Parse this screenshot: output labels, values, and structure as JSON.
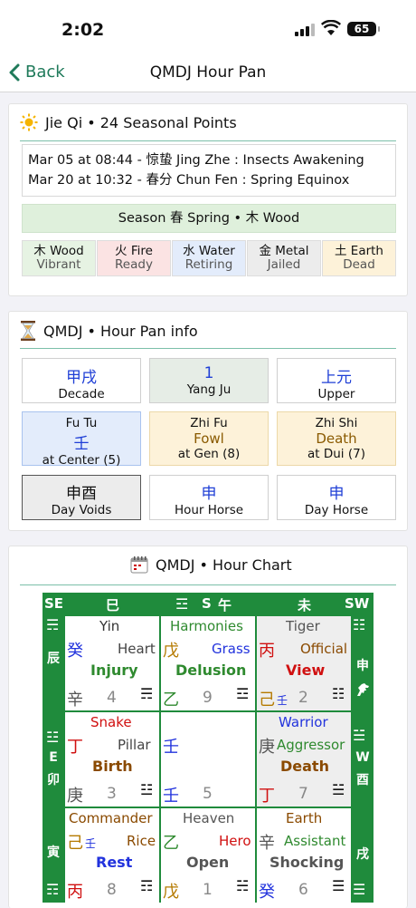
{
  "status": {
    "time": "2:02",
    "battery": "65"
  },
  "nav": {
    "back": "Back",
    "title": "QMDJ Hour Pan"
  },
  "jieqi": {
    "icon": "sun-icon",
    "title": "Jie Qi • 24 Seasonal Points",
    "terms": [
      "Mar 05 at 08:44 - 惊蛰 Jing Zhe : Insects Awakening",
      "Mar 20 at 10:32 - 春分 Chun Fen : Spring Equinox"
    ],
    "season": "Season 春 Spring • 木 Wood",
    "elements": [
      {
        "name": "木 Wood",
        "state": "Vibrant",
        "bg": "#e6f3e3"
      },
      {
        "name": "火 Fire",
        "state": "Ready",
        "bg": "#fbe3e3"
      },
      {
        "name": "水 Water",
        "state": "Retiring",
        "bg": "#e3ecfb"
      },
      {
        "name": "金 Metal",
        "state": "Jailed",
        "bg": "#ececec"
      },
      {
        "name": "土 Earth",
        "state": "Dead",
        "bg": "#fdf2d9"
      }
    ]
  },
  "info": {
    "icon": "hourglass-icon",
    "title": "QMDJ • Hour Pan info",
    "decade": {
      "value": "甲戌",
      "label": "Decade"
    },
    "ju": {
      "value": "1",
      "label": "Yang Ju"
    },
    "yuan": {
      "value": "上元",
      "label": "Upper"
    },
    "futu": {
      "l1": "Fu Tu",
      "l2": "壬",
      "l3": "at Center (5)"
    },
    "zhifu": {
      "l1": "Zhi Fu",
      "l2": "Fowl",
      "l3": "at Gen (8)"
    },
    "zhishi": {
      "l1": "Zhi Shi",
      "l2": "Death",
      "l3": "at Dui (7)"
    },
    "voids": {
      "value": "申酉",
      "label": "Day Voids"
    },
    "hhorse": {
      "value": "申",
      "label": "Hour Horse"
    },
    "dhorse": {
      "value": "申",
      "label": "Day Horse"
    }
  },
  "chart": {
    "icon": "calendar-icon",
    "title": "QMDJ • Hour Chart",
    "top": {
      "se": "SE",
      "b1": "巳",
      "s": "S",
      "b2": "午",
      "b3": "未",
      "sw": "SW"
    },
    "left": {
      "chen": "辰",
      "e": "E",
      "mao": "卯",
      "yin": "寅"
    },
    "right": {
      "shen": "申",
      "w": "W",
      "you": "酉",
      "xu": "戌"
    },
    "cells": {
      "se": {
        "deity": "Yin",
        "heavenStem": "癸",
        "star": "Heart",
        "door": "Injury",
        "earthStem": "辛",
        "num": "4",
        "aux": ""
      },
      "s": {
        "deity": "Harmonies",
        "heavenStem": "戊",
        "star": "Grass",
        "door": "Delusion",
        "earthStem": "乙",
        "num": "9"
      },
      "sw": {
        "deity": "Tiger",
        "heavenStem": "丙",
        "star": "Official",
        "door": "View",
        "earthStem": "己",
        "aux": "壬",
        "num": "2"
      },
      "e": {
        "deity": "Snake",
        "heavenStem": "丁",
        "star": "Pillar",
        "door": "Birth",
        "earthStem": "庚",
        "num": "3"
      },
      "c": {
        "heavenStem": "壬",
        "earthStem": "壬",
        "num": "5"
      },
      "w": {
        "deity": "Warrior",
        "heavenStem": "庚",
        "star": "Aggressor",
        "door": "Death",
        "earthStem": "丁",
        "num": "7"
      },
      "ne": {
        "deity": "Commander",
        "heavenStem": "己",
        "aux": "壬",
        "star": "Rice",
        "door": "Rest",
        "earthStem": "丙",
        "num": "8"
      },
      "n": {
        "deity": "Heaven",
        "heavenStem": "乙",
        "star": "Hero",
        "door": "Open",
        "earthStem": "戊",
        "num": "1"
      },
      "nw": {
        "deity": "Earth",
        "heavenStem": "辛",
        "star": "Assistant",
        "door": "Shocking",
        "earthStem": "癸",
        "num": "6"
      }
    }
  }
}
